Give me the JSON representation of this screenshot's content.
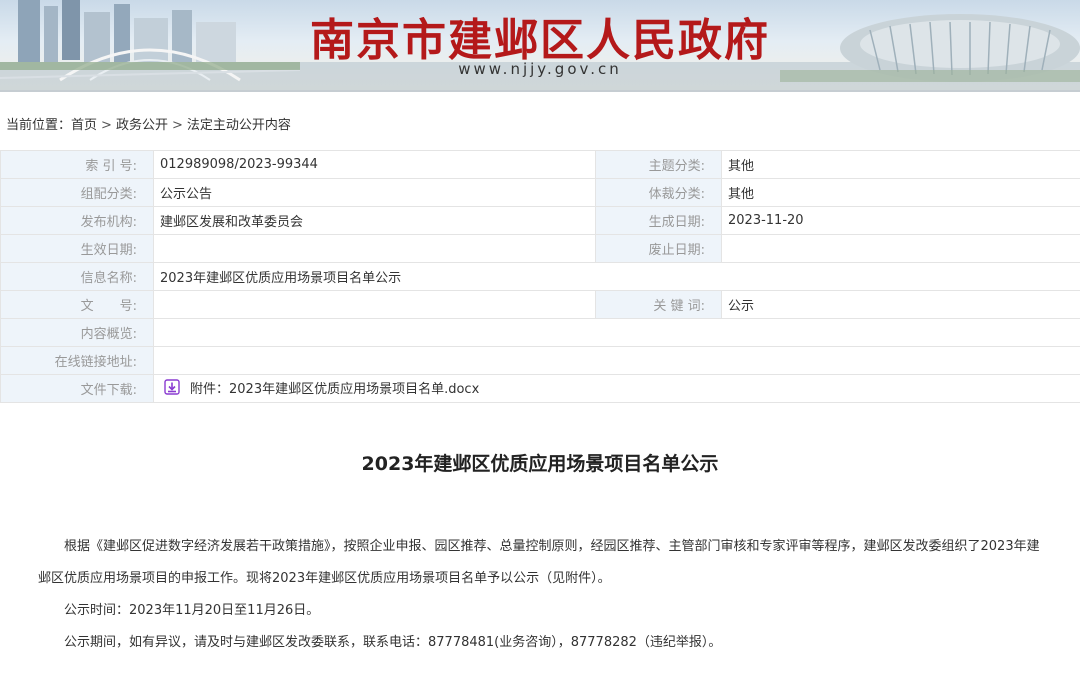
{
  "header": {
    "site_title": "南京市建邺区人民政府",
    "site_domain": "www.njjy.gov.cn",
    "title_color": "#b4191a"
  },
  "breadcrumb": {
    "prefix": "当前位置：",
    "items": [
      "首页",
      "政务公开",
      "法定主动公开内容"
    ],
    "separator": ">"
  },
  "meta": {
    "index_no_label": "索 引 号:",
    "index_no": "012989098/2023-99344",
    "topic_label": "主题分类:",
    "topic": "其他",
    "category_label": "组配分类:",
    "category": "公示公告",
    "genre_label": "体裁分类:",
    "genre": "其他",
    "publisher_label": "发布机构:",
    "publisher": "建邺区发展和改革委员会",
    "created_label": "生成日期:",
    "created": "2023-11-20",
    "effective_label": "生效日期:",
    "effective": "",
    "abolished_label": "废止日期:",
    "abolished": "",
    "info_name_label": "信息名称:",
    "info_name": "2023年建邺区优质应用场景项目名单公示",
    "doc_no_label": "文　　号:",
    "doc_no": "",
    "keywords_label": "关 键 词:",
    "keywords": "公示",
    "summary_label": "内容概览:",
    "summary": "",
    "online_link_label": "在线链接地址:",
    "online_link": "",
    "download_label": "文件下载:",
    "download_file": "附件：2023年建邺区优质应用场景项目名单.docx",
    "download_icon": "download-icon",
    "label_bg_color": "#eef4fa"
  },
  "article": {
    "title": "2023年建邺区优质应用场景项目名单公示",
    "paragraphs": [
      "根据《建邺区促进数字经济发展若干政策措施》，按照企业申报、园区推荐、总量控制原则，经园区推荐、主管部门审核和专家评审等程序，建邺区发改委组织了2023年建邺区优质应用场景项目的申报工作。现将2023年建邺区优质应用场景项目名单予以公示（见附件）。",
      "公示时间：2023年11月20日至11月26日。",
      "公示期间，如有异议，请及时与建邺区发改委联系，联系电话：87778481(业务咨询），87778282（违纪举报）。"
    ]
  }
}
